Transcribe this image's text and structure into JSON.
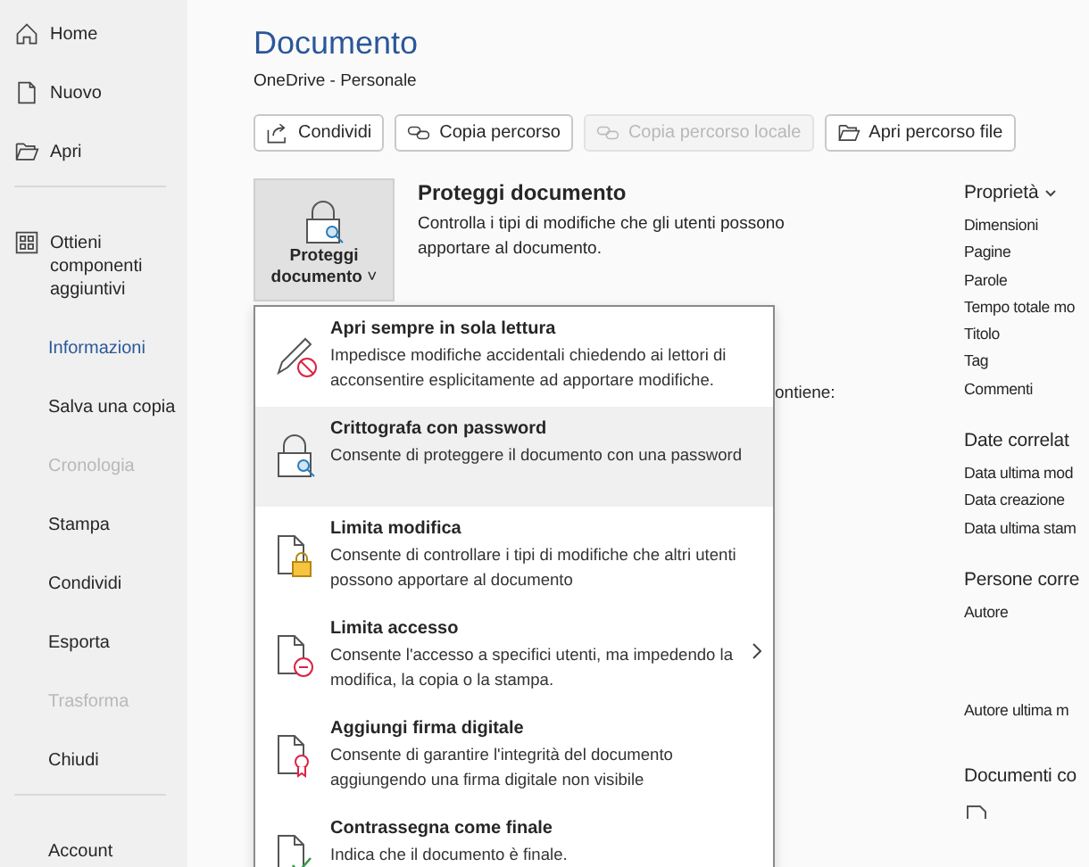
{
  "sidebar": {
    "items": [
      {
        "label": "Home",
        "selected": false,
        "disabled": false
      },
      {
        "label": "Nuovo",
        "selected": false,
        "disabled": false
      },
      {
        "label": "Apri",
        "selected": false,
        "disabled": false,
        "divider_after": true
      },
      {
        "label": "Ottieni componenti aggiuntivi",
        "selected": false,
        "disabled": false
      },
      {
        "label": "Informazioni",
        "selected": true,
        "disabled": false
      },
      {
        "label": "Salva una copia",
        "selected": false,
        "disabled": false
      },
      {
        "label": "Cronologia",
        "selected": false,
        "disabled": true
      },
      {
        "label": "Stampa",
        "selected": false,
        "disabled": false
      },
      {
        "label": "Condividi",
        "selected": false,
        "disabled": false
      },
      {
        "label": "Esporta",
        "selected": false,
        "disabled": false
      },
      {
        "label": "Trasforma",
        "selected": false,
        "disabled": true
      },
      {
        "label": "Chiudi",
        "selected": false,
        "disabled": false,
        "divider_after": true
      },
      {
        "label": "Account",
        "selected": false,
        "disabled": false
      }
    ]
  },
  "document": {
    "title": "Documento",
    "location": "OneDrive - Personale"
  },
  "toolbar": [
    {
      "label": "Condividi",
      "disabled": false
    },
    {
      "label": "Copia percorso",
      "disabled": false
    },
    {
      "label": "Copia percorso locale",
      "disabled": true
    },
    {
      "label": "Apri percorso file",
      "disabled": false
    }
  ],
  "protect": {
    "button": "Proteggi documento",
    "caret": "˅",
    "heading": "Proteggi documento",
    "description": "Controlla i tipi di modifiche che gli utenti possono apportare al documento.",
    "covered_text": "ontiene:"
  },
  "protect_menu": [
    {
      "kind": "pencil",
      "title": "Apri sempre in sola lettura",
      "description": "Impedisce modifiche accidentali chiedendo ai lettori di acconsentire esplicitamente ad apportare modifiche.",
      "selected": false
    },
    {
      "kind": "lock",
      "title": "Crittografa con password",
      "description": "Consente di proteggere il documento con una password",
      "selected": true
    },
    {
      "kind": "doc-lock",
      "title": "Limita modifica",
      "description": "Consente di controllare i tipi di modifiche che altri utenti possono apportare al documento",
      "selected": false
    },
    {
      "kind": "doc-minus",
      "title": "Limita accesso",
      "description": "Consente l'accesso a specifici utenti, ma impedendo la modifica, la copia o la stampa.",
      "selected": false,
      "submenu": true
    },
    {
      "kind": "doc-ribbon",
      "title": "Aggiungi firma digitale",
      "description": "Consente di garantire l'integrità del documento aggiungendo una firma digitale non visibile",
      "selected": false
    },
    {
      "kind": "doc-check",
      "title": "Contrassegna come finale",
      "description": "Indica che il documento è finale.",
      "selected": false
    }
  ],
  "properties": [
    {
      "kind": "list",
      "heading": "Proprietà",
      "caret": true,
      "items": [
        "Dimensioni",
        "Pagine",
        "Parole",
        "Tempo totale mo",
        "Titolo",
        "Tag",
        "Commenti"
      ]
    },
    {
      "kind": "list",
      "heading": "Date correlat",
      "caret": false,
      "items": [
        "Data ultima mod",
        "Data creazione",
        "Data ultima stam"
      ]
    },
    {
      "kind": "people",
      "heading": "Persone corre",
      "caret": false,
      "items": [
        "Autore",
        "Autore ultima m"
      ]
    },
    {
      "kind": "docs",
      "heading": "Documenti co",
      "caret": false
    }
  ]
}
